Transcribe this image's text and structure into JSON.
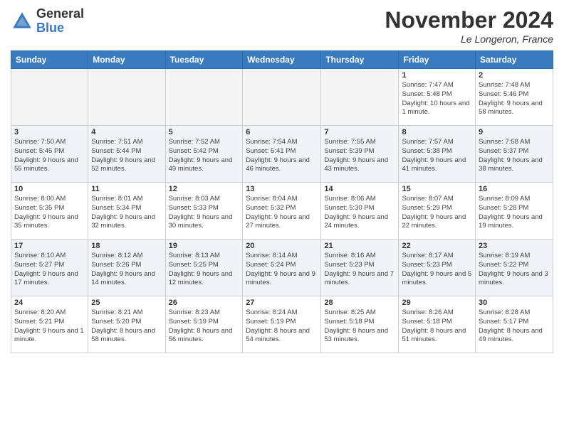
{
  "logo": {
    "text_general": "General",
    "text_blue": "Blue"
  },
  "header": {
    "month": "November 2024",
    "location": "Le Longeron, France"
  },
  "days_of_week": [
    "Sunday",
    "Monday",
    "Tuesday",
    "Wednesday",
    "Thursday",
    "Friday",
    "Saturday"
  ],
  "weeks": [
    {
      "days": [
        {
          "num": "",
          "empty": true
        },
        {
          "num": "",
          "empty": true
        },
        {
          "num": "",
          "empty": true
        },
        {
          "num": "",
          "empty": true
        },
        {
          "num": "",
          "empty": true
        },
        {
          "num": "1",
          "sunrise": "Sunrise: 7:47 AM",
          "sunset": "Sunset: 5:48 PM",
          "daylight": "Daylight: 10 hours and 1 minute."
        },
        {
          "num": "2",
          "sunrise": "Sunrise: 7:48 AM",
          "sunset": "Sunset: 5:46 PM",
          "daylight": "Daylight: 9 hours and 58 minutes."
        }
      ]
    },
    {
      "days": [
        {
          "num": "3",
          "sunrise": "Sunrise: 7:50 AM",
          "sunset": "Sunset: 5:45 PM",
          "daylight": "Daylight: 9 hours and 55 minutes."
        },
        {
          "num": "4",
          "sunrise": "Sunrise: 7:51 AM",
          "sunset": "Sunset: 5:44 PM",
          "daylight": "Daylight: 9 hours and 52 minutes."
        },
        {
          "num": "5",
          "sunrise": "Sunrise: 7:52 AM",
          "sunset": "Sunset: 5:42 PM",
          "daylight": "Daylight: 9 hours and 49 minutes."
        },
        {
          "num": "6",
          "sunrise": "Sunrise: 7:54 AM",
          "sunset": "Sunset: 5:41 PM",
          "daylight": "Daylight: 9 hours and 46 minutes."
        },
        {
          "num": "7",
          "sunrise": "Sunrise: 7:55 AM",
          "sunset": "Sunset: 5:39 PM",
          "daylight": "Daylight: 9 hours and 43 minutes."
        },
        {
          "num": "8",
          "sunrise": "Sunrise: 7:57 AM",
          "sunset": "Sunset: 5:38 PM",
          "daylight": "Daylight: 9 hours and 41 minutes."
        },
        {
          "num": "9",
          "sunrise": "Sunrise: 7:58 AM",
          "sunset": "Sunset: 5:37 PM",
          "daylight": "Daylight: 9 hours and 38 minutes."
        }
      ]
    },
    {
      "days": [
        {
          "num": "10",
          "sunrise": "Sunrise: 8:00 AM",
          "sunset": "Sunset: 5:35 PM",
          "daylight": "Daylight: 9 hours and 35 minutes."
        },
        {
          "num": "11",
          "sunrise": "Sunrise: 8:01 AM",
          "sunset": "Sunset: 5:34 PM",
          "daylight": "Daylight: 9 hours and 32 minutes."
        },
        {
          "num": "12",
          "sunrise": "Sunrise: 8:03 AM",
          "sunset": "Sunset: 5:33 PM",
          "daylight": "Daylight: 9 hours and 30 minutes."
        },
        {
          "num": "13",
          "sunrise": "Sunrise: 8:04 AM",
          "sunset": "Sunset: 5:32 PM",
          "daylight": "Daylight: 9 hours and 27 minutes."
        },
        {
          "num": "14",
          "sunrise": "Sunrise: 8:06 AM",
          "sunset": "Sunset: 5:30 PM",
          "daylight": "Daylight: 9 hours and 24 minutes."
        },
        {
          "num": "15",
          "sunrise": "Sunrise: 8:07 AM",
          "sunset": "Sunset: 5:29 PM",
          "daylight": "Daylight: 9 hours and 22 minutes."
        },
        {
          "num": "16",
          "sunrise": "Sunrise: 8:09 AM",
          "sunset": "Sunset: 5:28 PM",
          "daylight": "Daylight: 9 hours and 19 minutes."
        }
      ]
    },
    {
      "days": [
        {
          "num": "17",
          "sunrise": "Sunrise: 8:10 AM",
          "sunset": "Sunset: 5:27 PM",
          "daylight": "Daylight: 9 hours and 17 minutes."
        },
        {
          "num": "18",
          "sunrise": "Sunrise: 8:12 AM",
          "sunset": "Sunset: 5:26 PM",
          "daylight": "Daylight: 9 hours and 14 minutes."
        },
        {
          "num": "19",
          "sunrise": "Sunrise: 8:13 AM",
          "sunset": "Sunset: 5:25 PM",
          "daylight": "Daylight: 9 hours and 12 minutes."
        },
        {
          "num": "20",
          "sunrise": "Sunrise: 8:14 AM",
          "sunset": "Sunset: 5:24 PM",
          "daylight": "Daylight: 9 hours and 9 minutes."
        },
        {
          "num": "21",
          "sunrise": "Sunrise: 8:16 AM",
          "sunset": "Sunset: 5:23 PM",
          "daylight": "Daylight: 9 hours and 7 minutes."
        },
        {
          "num": "22",
          "sunrise": "Sunrise: 8:17 AM",
          "sunset": "Sunset: 5:23 PM",
          "daylight": "Daylight: 9 hours and 5 minutes."
        },
        {
          "num": "23",
          "sunrise": "Sunrise: 8:19 AM",
          "sunset": "Sunset: 5:22 PM",
          "daylight": "Daylight: 9 hours and 3 minutes."
        }
      ]
    },
    {
      "days": [
        {
          "num": "24",
          "sunrise": "Sunrise: 8:20 AM",
          "sunset": "Sunset: 5:21 PM",
          "daylight": "Daylight: 9 hours and 1 minute."
        },
        {
          "num": "25",
          "sunrise": "Sunrise: 8:21 AM",
          "sunset": "Sunset: 5:20 PM",
          "daylight": "Daylight: 8 hours and 58 minutes."
        },
        {
          "num": "26",
          "sunrise": "Sunrise: 8:23 AM",
          "sunset": "Sunset: 5:19 PM",
          "daylight": "Daylight: 8 hours and 56 minutes."
        },
        {
          "num": "27",
          "sunrise": "Sunrise: 8:24 AM",
          "sunset": "Sunset: 5:19 PM",
          "daylight": "Daylight: 8 hours and 54 minutes."
        },
        {
          "num": "28",
          "sunrise": "Sunrise: 8:25 AM",
          "sunset": "Sunset: 5:18 PM",
          "daylight": "Daylight: 8 hours and 53 minutes."
        },
        {
          "num": "29",
          "sunrise": "Sunrise: 8:26 AM",
          "sunset": "Sunset: 5:18 PM",
          "daylight": "Daylight: 8 hours and 51 minutes."
        },
        {
          "num": "30",
          "sunrise": "Sunrise: 8:28 AM",
          "sunset": "Sunset: 5:17 PM",
          "daylight": "Daylight: 8 hours and 49 minutes."
        }
      ]
    }
  ]
}
